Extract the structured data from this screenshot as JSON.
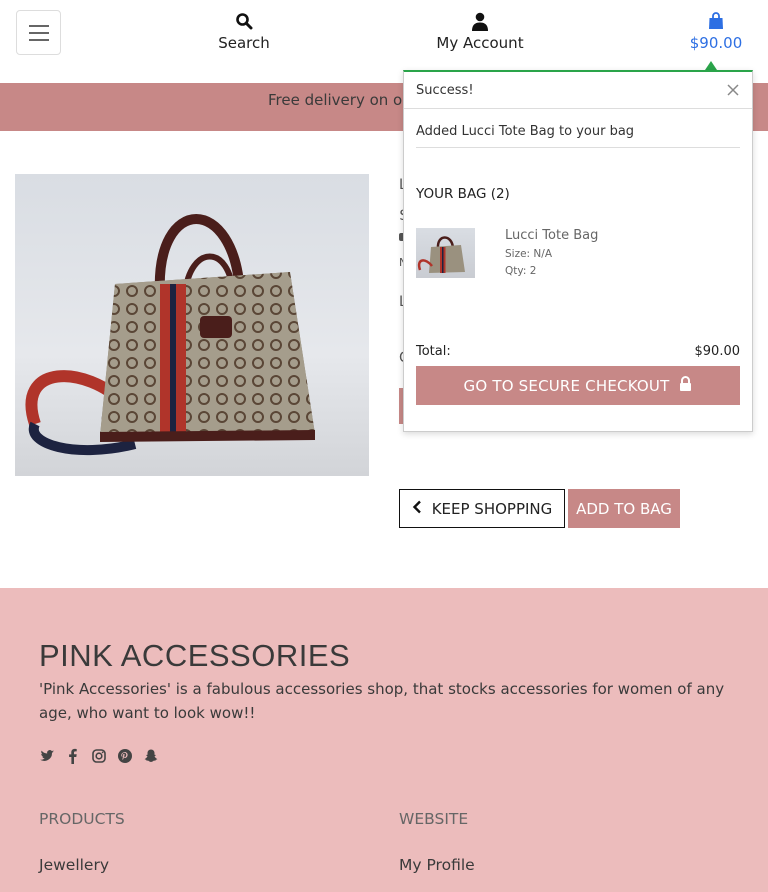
{
  "header": {
    "search_label": "Search",
    "account_label": "My Account",
    "bag_total": "$90.00"
  },
  "banner": {
    "text": "Free delivery on ord"
  },
  "product": {
    "partial_glyphs": [
      "L",
      "$",
      "N",
      "L",
      "C"
    ]
  },
  "actions": {
    "keep_shopping": "KEEP SHOPPING",
    "add_to_bag": "ADD TO BAG"
  },
  "popup": {
    "title": "Success!",
    "message": "Added Lucci Tote Bag to your bag",
    "bag_heading": "YOUR BAG (2)",
    "item": {
      "name": "Lucci Tote Bag",
      "size": "Size: N/A",
      "qty": "Qty: 2"
    },
    "total_label": "Total:",
    "total_value": "$90.00",
    "checkout_label": "GO TO SECURE CHECKOUT"
  },
  "footer": {
    "brand": "PINK ACCESSORIES",
    "tagline": "'Pink Accessories' is a fabulous accessories shop, that stocks accessories for women of any age, who want to look wow!!",
    "social_icons": [
      "twitter-icon",
      "facebook-icon",
      "instagram-icon",
      "pinterest-icon",
      "snapchat-icon"
    ],
    "products_heading": "PRODUCTS",
    "website_heading": "WEBSITE",
    "products_link": "Jewellery",
    "website_link": "My Profile"
  },
  "colors": {
    "accent": "#c78887",
    "footer_bg": "#ecbcbc",
    "link_blue": "#2d6fe3",
    "success_green": "#2aa44a"
  }
}
